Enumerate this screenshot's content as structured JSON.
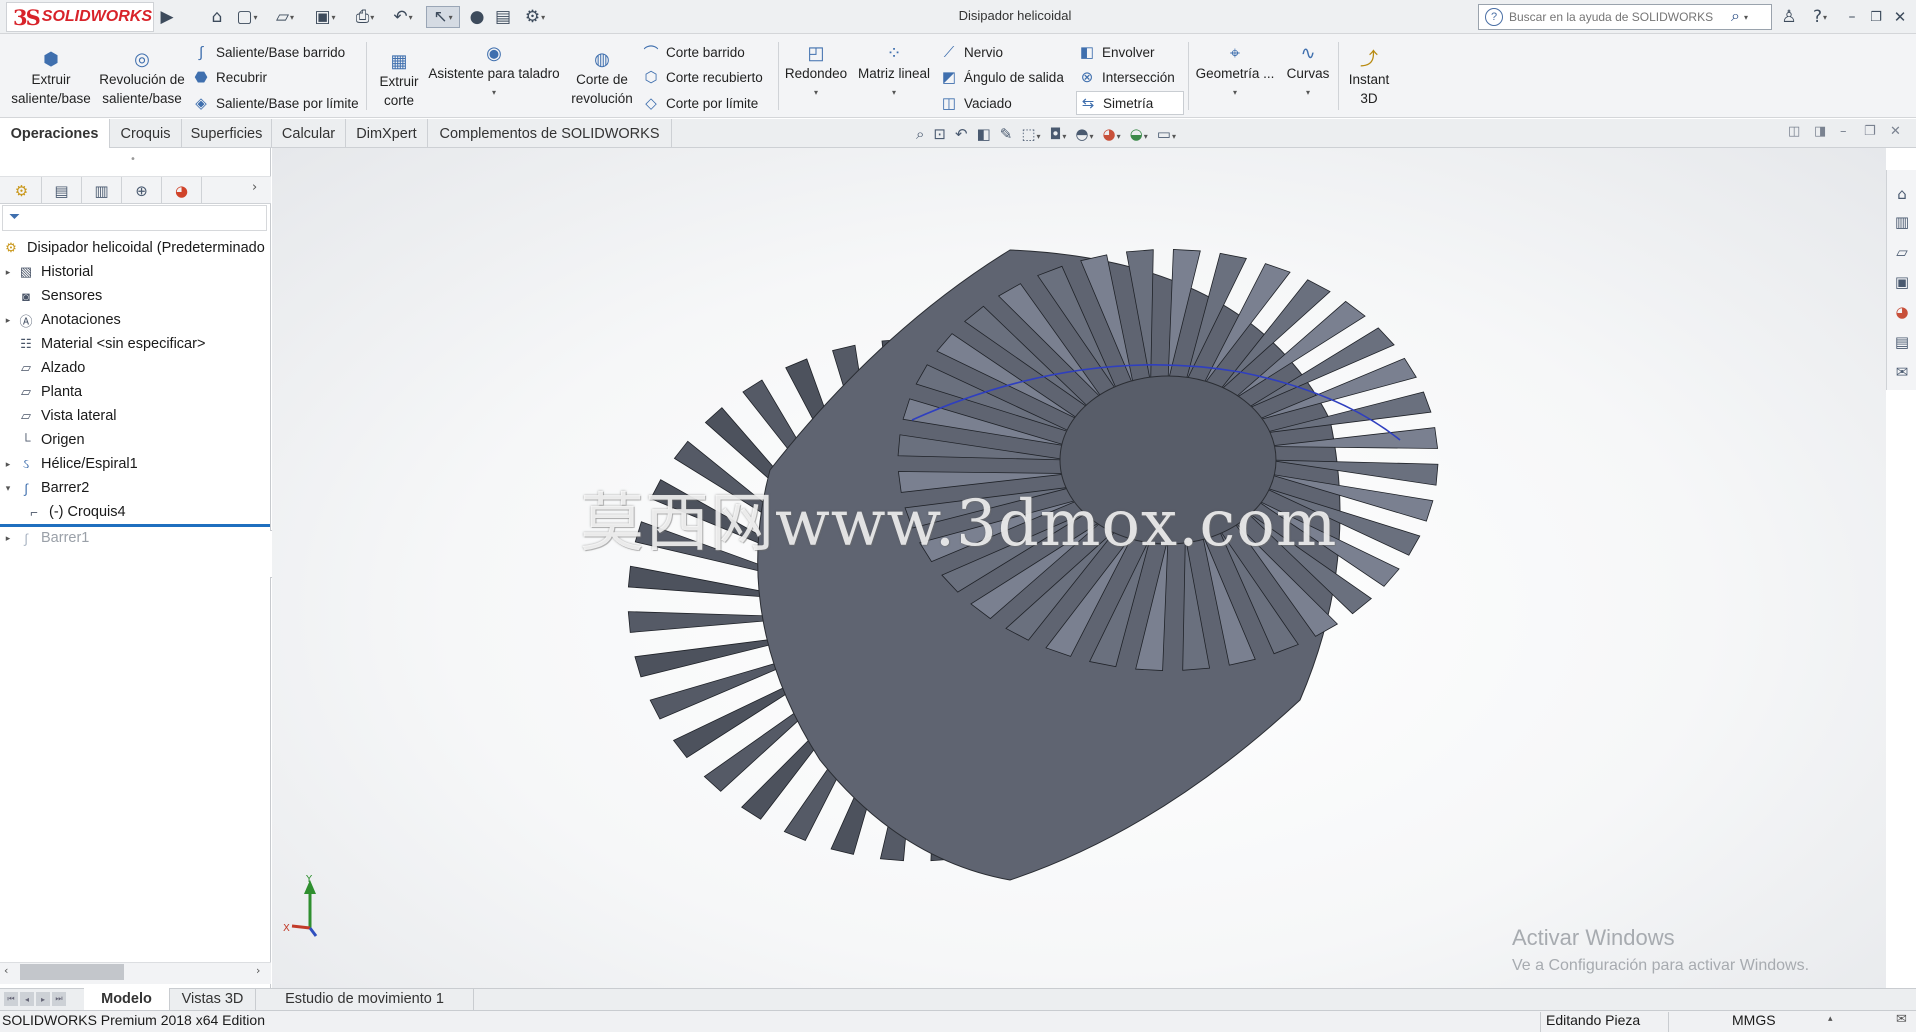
{
  "app": {
    "logo_ds": "3S",
    "logo_text": "SOLIDWORKS",
    "document_title": "Disipador helicoidal",
    "search_placeholder": "Buscar en la ayuda de SOLIDWORKS"
  },
  "ribbon": {
    "extrude_boss": [
      "Extruir",
      "saliente/base"
    ],
    "revolve_boss": [
      "Revolución de",
      "saliente/base"
    ],
    "swept_boss": "Saliente/Base barrido",
    "loft_boss": "Recubrir",
    "boundary_boss": "Saliente/Base por límite",
    "extrude_cut": [
      "Extruir",
      "corte"
    ],
    "hole_wizard": "Asistente para taladro",
    "revolve_cut": [
      "Corte de",
      "revolución"
    ],
    "swept_cut": "Corte barrido",
    "lofted_cut": "Corte recubierto",
    "boundary_cut": "Corte por límite",
    "fillet": "Redondeo",
    "linear_pattern": "Matriz lineal",
    "rib": "Nervio",
    "draft": "Ángulo de salida",
    "shell": "Vaciado",
    "wrap": "Envolver",
    "intersect": "Intersección",
    "mirror": "Simetría",
    "ref_geometry": "Geometría ...",
    "curves": "Curvas",
    "instant3d": [
      "Instant",
      "3D"
    ]
  },
  "tabs": [
    "Operaciones",
    "Croquis",
    "Superficies",
    "Calcular",
    "DimXpert",
    "Complementos de SOLIDWORKS"
  ],
  "tree": {
    "root": "Disipador helicoidal  (Predeterminado",
    "items": [
      {
        "label": "Historial",
        "icon": "history-icon",
        "expandable": true
      },
      {
        "label": "Sensores",
        "icon": "sensor-icon",
        "expandable": false
      },
      {
        "label": "Anotaciones",
        "icon": "annotation-icon",
        "expandable": true
      },
      {
        "label": "Material <sin especificar>",
        "icon": "material-icon",
        "expandable": false
      },
      {
        "label": "Alzado",
        "icon": "plane-icon",
        "expandable": false
      },
      {
        "label": "Planta",
        "icon": "plane-icon",
        "expandable": false
      },
      {
        "label": "Vista lateral",
        "icon": "plane-icon",
        "expandable": false
      },
      {
        "label": "Origen",
        "icon": "origin-icon",
        "expandable": false
      },
      {
        "label": "Hélice/Espiral1",
        "icon": "helix-icon",
        "expandable": true
      },
      {
        "label": "Barrer2",
        "icon": "sweep-icon",
        "expandable": true,
        "expanded": true
      },
      {
        "label": "(-) Croquis4",
        "icon": "sketch-icon",
        "child": true
      },
      {
        "label": "Barrer1",
        "icon": "sweep-icon",
        "expandable": true,
        "suppressed": true
      }
    ]
  },
  "bottom_tabs": [
    "Modelo",
    "Vistas 3D",
    "Estudio de movimiento 1"
  ],
  "status": {
    "edition": "SOLIDWORKS Premium 2018 x64 Edition",
    "mode": "Editando Pieza",
    "units": "MMGS"
  },
  "activation": {
    "title": "Activar Windows",
    "subtitle": "Ve a Configuración para activar Windows."
  },
  "watermark": "莫西网www.3dmox.com",
  "triad": {
    "y": "Y",
    "x": "X"
  },
  "colors": {
    "brand": "#d8232a",
    "accent": "#1f6fbf",
    "model": "#5d6270"
  }
}
